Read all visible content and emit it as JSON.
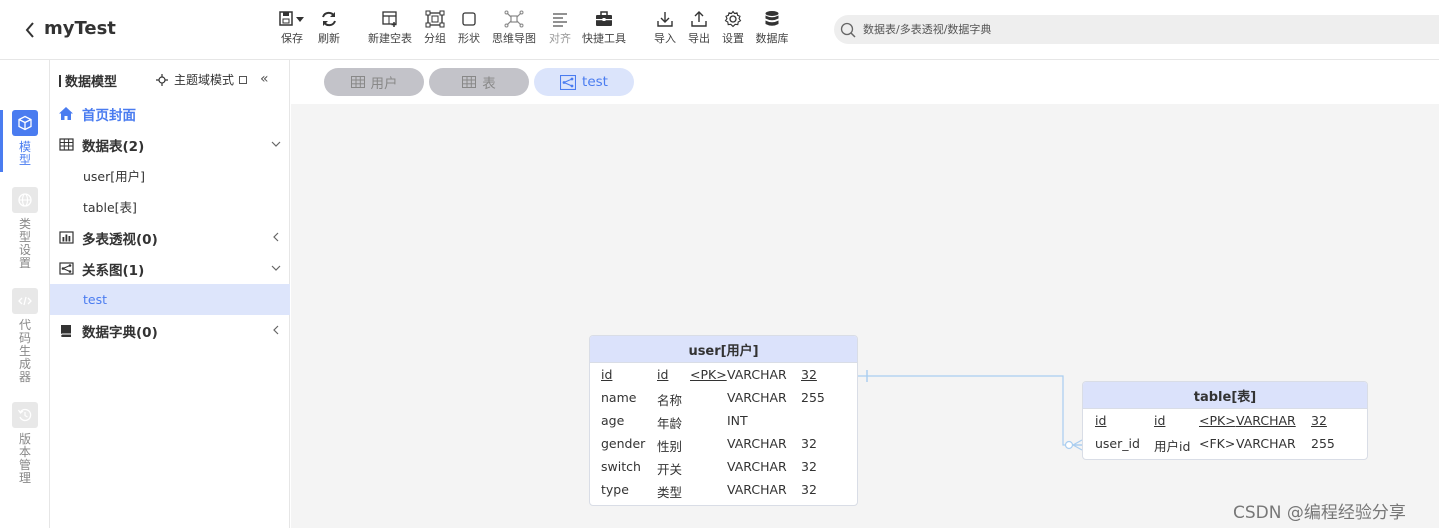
{
  "app": {
    "title": "myTest"
  },
  "toolbar": {
    "items": [
      {
        "label": "保存",
        "icon": "save-icon"
      },
      {
        "label": "刷新",
        "icon": "refresh-icon"
      },
      {
        "label": "新建空表",
        "icon": "new-table-icon"
      },
      {
        "label": "分组",
        "icon": "group-icon"
      },
      {
        "label": "形状",
        "icon": "shape-icon"
      },
      {
        "label": "思维导图",
        "icon": "mindmap-icon"
      },
      {
        "label": "对齐",
        "icon": "align-icon"
      },
      {
        "label": "快捷工具",
        "icon": "toolbox-icon"
      },
      {
        "label": "导入",
        "icon": "import-icon"
      },
      {
        "label": "导出",
        "icon": "export-icon"
      },
      {
        "label": "设置",
        "icon": "gear-icon"
      },
      {
        "label": "数据库",
        "icon": "database-icon"
      }
    ]
  },
  "search": {
    "placeholder": "数据表/多表透视/数据字典"
  },
  "rail": {
    "items": [
      {
        "label": "模型",
        "icon": "cube-icon",
        "active": true
      },
      {
        "label": "类型设置",
        "icon": "globe-icon",
        "active": false
      },
      {
        "label": "代码生成器",
        "icon": "code-icon",
        "active": false
      },
      {
        "label": "版本管理",
        "icon": "history-icon",
        "active": false
      }
    ]
  },
  "panel": {
    "title": "数据模型",
    "theme_mode": "主题域模式",
    "collapse": "«",
    "tree": {
      "home": "首页封面",
      "tables": "数据表(2)",
      "table_items": [
        "user[用户]",
        "table[表]"
      ],
      "pivots": "多表透视(0)",
      "relations": "关系图(1)",
      "relation_items": [
        "test"
      ],
      "dicts": "数据字典(0)"
    }
  },
  "tabs": [
    {
      "label": "用户",
      "icon": "table-icon",
      "active": false
    },
    {
      "label": "表",
      "icon": "table-icon",
      "active": false
    },
    {
      "label": "test",
      "icon": "relation-icon",
      "active": true
    }
  ],
  "diagram": {
    "entities": [
      {
        "title": "user[用户]",
        "rows": [
          {
            "code": "id",
            "name": "id",
            "key": "<PK>",
            "type": "VARCHAR",
            "len": "32",
            "underline": true
          },
          {
            "code": "name",
            "name": "名称",
            "key": "",
            "type": "VARCHAR",
            "len": "255",
            "underline": false
          },
          {
            "code": "age",
            "name": "年龄",
            "key": "",
            "type": "INT",
            "len": "",
            "underline": false
          },
          {
            "code": "gender",
            "name": "性别",
            "key": "",
            "type": "VARCHAR",
            "len": "32",
            "underline": false
          },
          {
            "code": "switch",
            "name": "开关",
            "key": "",
            "type": "VARCHAR",
            "len": "32",
            "underline": false
          },
          {
            "code": "type",
            "name": "类型",
            "key": "",
            "type": "VARCHAR",
            "len": "32",
            "underline": false
          }
        ]
      },
      {
        "title": "table[表]",
        "rows": [
          {
            "code": "id",
            "name": "id",
            "key": "<PK>",
            "type": "VARCHAR",
            "len": "32",
            "underline": true
          },
          {
            "code": "user_id",
            "name": "用户id",
            "key": "<FK>",
            "type": "VARCHAR",
            "len": "255",
            "underline": false
          }
        ]
      }
    ],
    "link_color": "#a9cdf0"
  },
  "watermark": "CSDN @编程经验分享",
  "colors": {
    "accent": "#4a7cf0",
    "tab_inactive": "#c3c3c9",
    "entity_head": "#dbe2fb",
    "selected_row": "#dde5fb"
  }
}
